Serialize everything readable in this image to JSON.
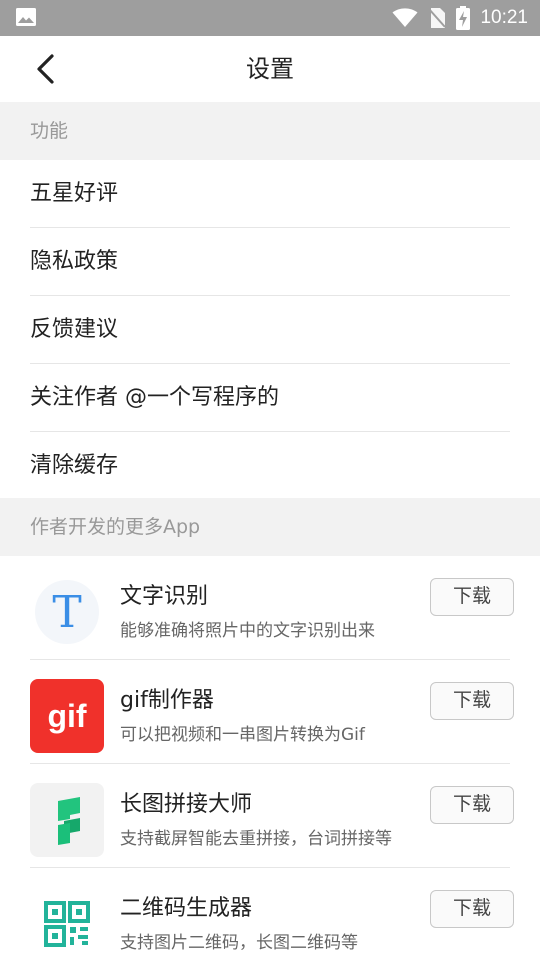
{
  "status_bar": {
    "time": "10:21",
    "icons": [
      "gallery-icon",
      "wifi-icon",
      "no-sim-icon",
      "battery-charging-icon"
    ]
  },
  "toolbar": {
    "title": "设置",
    "back_icon": "chevron-left-icon"
  },
  "sections": {
    "features_header": "功能",
    "more_apps_header": "作者开发的更多App"
  },
  "menu": {
    "items": [
      {
        "label": "五星好评"
      },
      {
        "label": "隐私政策"
      },
      {
        "label": "反馈建议"
      },
      {
        "label": "关注作者 @一个写程序的"
      },
      {
        "label": "清除缓存"
      }
    ]
  },
  "apps": [
    {
      "name": "文字识别",
      "desc": "能够准确将照片中的文字识别出来",
      "button": "下载",
      "icon": "ocr-t-icon",
      "icon_text": "T"
    },
    {
      "name": "gif制作器",
      "desc": "可以把视频和一串图片转换为Gif",
      "button": "下载",
      "icon": "gif-maker-icon",
      "icon_text": "gif"
    },
    {
      "name": "长图拼接大师",
      "desc": "支持截屏智能去重拼接，台词拼接等",
      "button": "下载",
      "icon": "stitch-icon"
    },
    {
      "name": "二维码生成器",
      "desc": "支持图片二维码，长图二维码等",
      "button": "下载",
      "icon": "qr-code-icon"
    }
  ],
  "colors": {
    "status_bar": "#9e9e9e",
    "section_bg": "#f2f2f2",
    "gif_red": "#f0312b",
    "ocr_blue": "#3a8ee6",
    "stitch_green": "#1bbf7a",
    "qr_teal": "#22b39a"
  }
}
